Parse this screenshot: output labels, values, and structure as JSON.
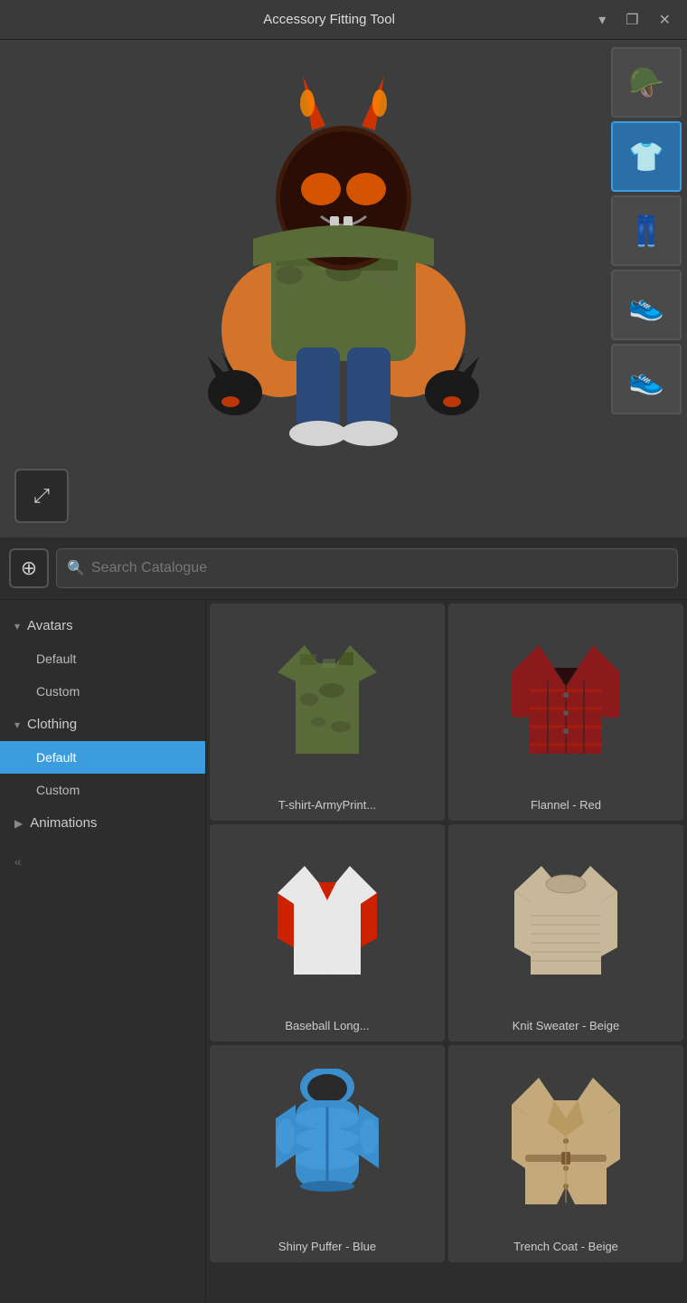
{
  "titlebar": {
    "title": "Accessory Fitting Tool",
    "minimize_icon": "▾",
    "maximize_icon": "❐",
    "close_icon": "✕"
  },
  "preview": {
    "expand_icon": "⤢"
  },
  "search": {
    "add_icon": "⊕",
    "search_placeholder": "Search Catalogue"
  },
  "sidebar": {
    "sections": [
      {
        "id": "avatars",
        "label": "Avatars",
        "expanded": true,
        "items": [
          {
            "id": "avatars-default",
            "label": "Default",
            "active": false
          },
          {
            "id": "avatars-custom",
            "label": "Custom",
            "active": false
          }
        ]
      },
      {
        "id": "clothing",
        "label": "Clothing",
        "expanded": true,
        "items": [
          {
            "id": "clothing-default",
            "label": "Default",
            "active": true
          },
          {
            "id": "clothing-custom",
            "label": "Custom",
            "active": false
          }
        ]
      },
      {
        "id": "animations",
        "label": "Animations",
        "expanded": false,
        "items": []
      }
    ]
  },
  "slots": [
    {
      "id": "slot-1",
      "emoji": "🪖",
      "selected": false
    },
    {
      "id": "slot-2",
      "emoji": "👕",
      "selected": true
    },
    {
      "id": "slot-3",
      "emoji": "👖",
      "selected": false
    },
    {
      "id": "slot-4",
      "emoji": "👟",
      "selected": false
    },
    {
      "id": "slot-5",
      "emoji": "👟",
      "selected": false
    }
  ],
  "catalog": {
    "items": [
      {
        "id": "item-1",
        "label": "T-shirt-ArmyPrint...",
        "color": "#5a6b3a",
        "type": "tshirt-camo"
      },
      {
        "id": "item-2",
        "label": "Flannel - Red",
        "color": "#8b1a1a",
        "type": "flannel-red"
      },
      {
        "id": "item-3",
        "label": "Baseball Long...",
        "color": "#cccccc",
        "type": "baseball-long"
      },
      {
        "id": "item-4",
        "label": "Knit Sweater - Beige",
        "color": "#c8b89a",
        "type": "knit-beige"
      },
      {
        "id": "item-5",
        "label": "Shiny Puffer - Blue",
        "color": "#3a8fcc",
        "type": "puffer-blue"
      },
      {
        "id": "item-6",
        "label": "Trench Coat - Beige",
        "color": "#c4a97a",
        "type": "trench-beige"
      }
    ]
  },
  "bottom_bar": {
    "collapse_label": "«"
  }
}
